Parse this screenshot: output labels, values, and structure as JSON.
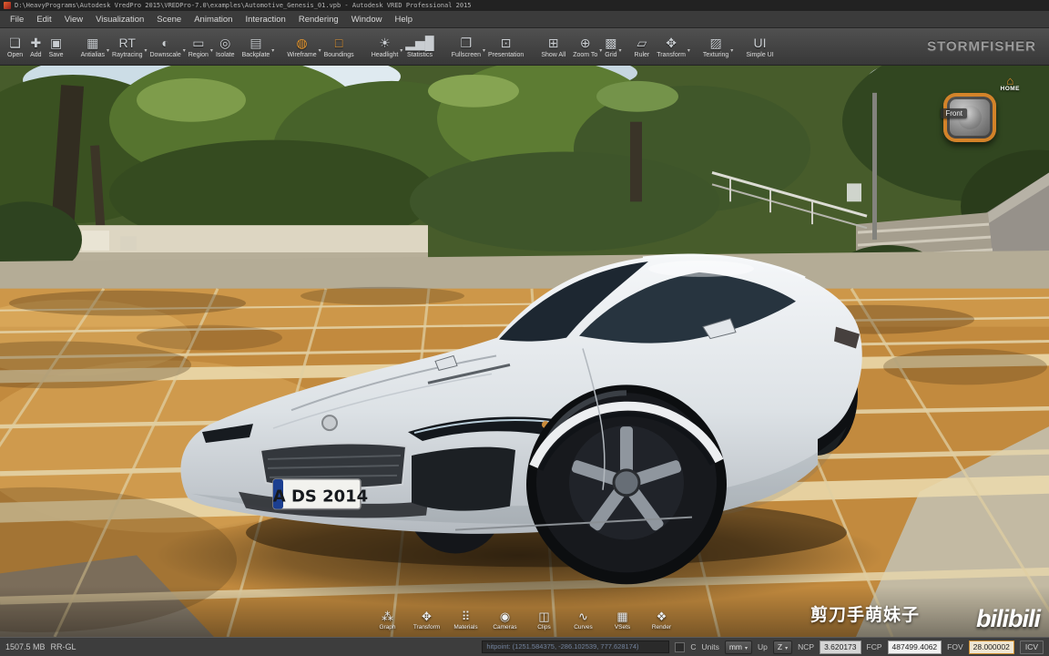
{
  "titlebar": {
    "title": "D:\\HeavyPrograms\\Autodesk VredPro 2015\\VREDPro-7.0\\examples\\Automotive_Genesis_01.vpb - Autodesk VRED Professional 2015"
  },
  "menubar": {
    "items": [
      "File",
      "Edit",
      "View",
      "Visualization",
      "Scene",
      "Animation",
      "Interaction",
      "Rendering",
      "Window",
      "Help"
    ]
  },
  "toolbar": {
    "brand": "STORMFISHER",
    "items": [
      {
        "label": "Open",
        "glyph": "❏"
      },
      {
        "label": "Add",
        "glyph": "✚"
      },
      {
        "label": "Save",
        "glyph": "▣"
      },
      {
        "label": "Antialias",
        "glyph": "▦",
        "dd": true,
        "gap": true
      },
      {
        "label": "Raytracing",
        "glyph": "RT",
        "boxed": true,
        "dd": true
      },
      {
        "label": "Downscale",
        "glyph": "◐",
        "dd": true
      },
      {
        "label": "Region",
        "glyph": "▭",
        "dd": true
      },
      {
        "label": "Isolate",
        "glyph": "◎"
      },
      {
        "label": "Backplate",
        "glyph": "▤",
        "dd": true
      },
      {
        "label": "Wireframe",
        "glyph": "◍",
        "accent": true,
        "dd": true,
        "gap": true
      },
      {
        "label": "Boundings",
        "glyph": "□",
        "accent": true
      },
      {
        "label": "Headlight",
        "glyph": "☀",
        "dd": true,
        "gap": true
      },
      {
        "label": "Statistics",
        "glyph": "▂▅█"
      },
      {
        "label": "Fullscreen",
        "glyph": "❒",
        "dd": true,
        "gap": true
      },
      {
        "label": "Presentation",
        "glyph": "⊡"
      },
      {
        "label": "Show All",
        "glyph": "⊞",
        "gap": true
      },
      {
        "label": "Zoom To",
        "glyph": "⊕",
        "dd": true
      },
      {
        "label": "Grid",
        "glyph": "▩",
        "dd": true
      },
      {
        "label": "Ruler",
        "glyph": "▱",
        "gap": true
      },
      {
        "label": "Transform",
        "glyph": "✥",
        "dd": true
      },
      {
        "label": "Texturing",
        "glyph": "▨",
        "dd": true,
        "gap": true
      },
      {
        "label": "Simple UI",
        "glyph": "UI",
        "boxed": true,
        "gap": true
      }
    ]
  },
  "viewport": {
    "navigator": {
      "home": "HOME",
      "view": "Front"
    },
    "car_plate": "A DS 2014",
    "watermark": "剪刀手萌妹子",
    "logo": "bilibili",
    "dock": {
      "items": [
        {
          "label": "Graph",
          "glyph": "⁂"
        },
        {
          "label": "Transform",
          "glyph": "✥"
        },
        {
          "label": "Materials",
          "glyph": "⠿"
        },
        {
          "label": "Cameras",
          "glyph": "◉"
        },
        {
          "label": "Clips",
          "glyph": "◫"
        },
        {
          "label": "Curves",
          "glyph": "∿"
        },
        {
          "label": "VSets",
          "glyph": "▦"
        },
        {
          "label": "Render",
          "glyph": "❖"
        }
      ]
    }
  },
  "statusbar": {
    "memory": "1507.5 MB",
    "renderer": "RR-GL",
    "hitpoint": "hitpoint: (1251.584375, -286.102539, 777.628174)",
    "c_label": "C",
    "units_label": "Units",
    "units_value": "mm",
    "up_label": "Up",
    "up_value": "Z",
    "ncp_label": "NCP",
    "ncp_value": "3.620173",
    "fcp_label": "FCP",
    "fcp_value": "487499.4062",
    "fov_label": "FOV",
    "fov_value": "28.000002",
    "icv_label": "ICV"
  },
  "colors": {
    "accent": "#e8952f"
  }
}
